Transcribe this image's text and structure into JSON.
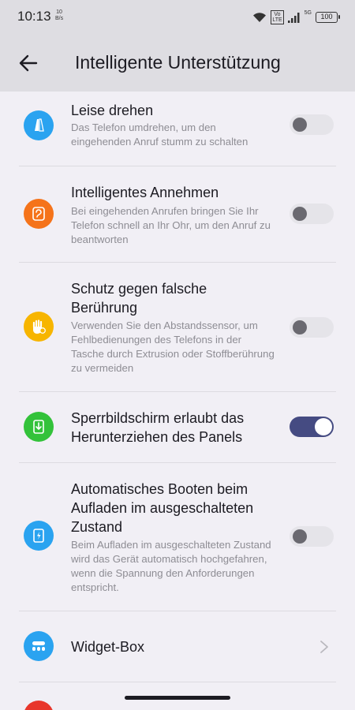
{
  "status_bar": {
    "time": "10:13",
    "speed_value": "10",
    "speed_unit": "B/s",
    "volte_top": "Vo",
    "volte_bottom": "LTE",
    "network": "5G",
    "battery": "100"
  },
  "header": {
    "title": "Intelligente Unterstützung"
  },
  "settings": [
    {
      "title": "Leise drehen",
      "description": "Das Telefon umdrehen, um den eingehenden Anruf stumm zu schalten",
      "icon": "flip-phone-icon",
      "color": "#2aa3f0",
      "enabled": false
    },
    {
      "title": "Intelligentes Annehmen",
      "description": "Bei eingehenden Anrufen bringen Sie Ihr Telefon schnell an Ihr Ohr, um den Anruf zu beantworten",
      "icon": "ear-icon",
      "color": "#f5731a",
      "enabled": false
    },
    {
      "title": "Schutz gegen falsche Berührung",
      "description": "Verwenden Sie den Abstandssensor, um Fehlbedienungen des Telefons in der Tasche durch Extrusion oder Stoffberührung zu vermeiden",
      "icon": "hand-icon",
      "color": "#f7b500",
      "enabled": false
    },
    {
      "title": "Sperrbildschirm erlaubt das Herunterziehen des Panels",
      "description": "",
      "icon": "pull-down-panel-icon",
      "color": "#33c23a",
      "enabled": true
    },
    {
      "title": "Automatisches Booten beim Aufladen im ausgeschalteten Zustand",
      "description": "Beim Aufladen im ausgeschalteten Zustand wird das Gerät automatisch hochgefahren, wenn die Spannung den Anforderungen entspricht.",
      "icon": "charging-phone-icon",
      "color": "#2aa3f0",
      "enabled": false
    },
    {
      "title": "Widget-Box",
      "description": "",
      "icon": "widget-box-icon",
      "color": "#2aa3f0"
    }
  ]
}
